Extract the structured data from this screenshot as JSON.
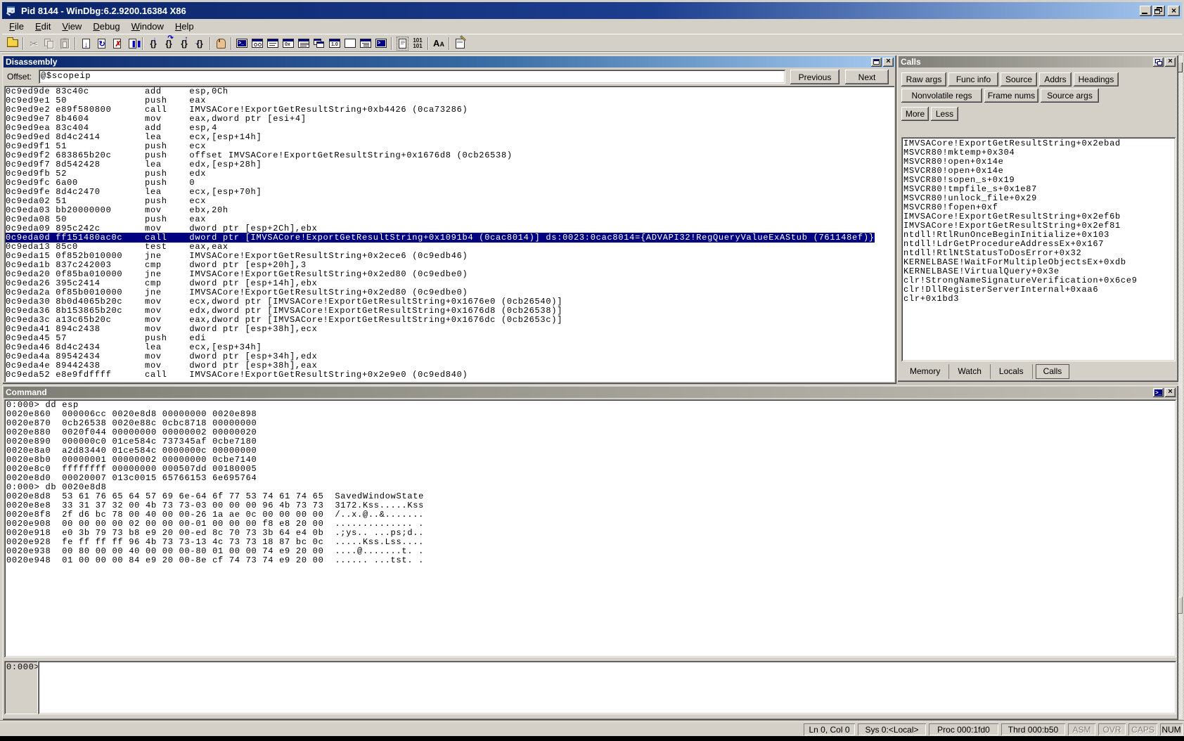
{
  "window": {
    "title": "Pid 8144 - WinDbg:6.2.9200.16384 X86"
  },
  "menu": [
    "File",
    "Edit",
    "View",
    "Debug",
    "Window",
    "Help"
  ],
  "toolbar": {
    "groups": [
      [
        "open-source-file-icon"
      ],
      [
        "cut-icon",
        "copy-icon",
        "paste-icon"
      ],
      [
        "go-icon",
        "restart-icon",
        "stop-debugging-icon",
        "break-icon"
      ],
      [
        "step-into-icon",
        "step-over-icon",
        "step-out-icon",
        "run-to-cursor-icon"
      ],
      [
        "breakpoint-hand-icon"
      ],
      [
        "command-window-icon",
        "watch-window-icon",
        "locals-window-icon",
        "registers-window-icon",
        "memory-window-icon",
        "call-stack-window-icon",
        "disassembly-window-icon",
        "scratch-pad-icon",
        "processes-threads-icon",
        "command-browser-icon"
      ],
      [
        "source-mode-icon",
        "assembly-options-icon"
      ],
      [
        "font-icon"
      ],
      [
        "options-icon"
      ]
    ]
  },
  "disassembly": {
    "title": "Disassembly",
    "offset_label": "Offset:",
    "offset_value": "@$scopeip",
    "previous_label": "Previous",
    "next_label": "Next",
    "highlight_index": 16,
    "lines": [
      "0c9ed9de 83c40c          add     esp,0Ch",
      "0c9ed9e1 50              push    eax",
      "0c9ed9e2 e89f580800      call    IMVSACore!ExportGetResultString+0xb4426 (0ca73286)",
      "0c9ed9e7 8b4604          mov     eax,dword ptr [esi+4]",
      "0c9ed9ea 83c404          add     esp,4",
      "0c9ed9ed 8d4c2414        lea     ecx,[esp+14h]",
      "0c9ed9f1 51              push    ecx",
      "0c9ed9f2 683865b20c      push    offset IMVSACore!ExportGetResultString+0x1676d8 (0cb26538)",
      "0c9ed9f7 8d542428        lea     edx,[esp+28h]",
      "0c9ed9fb 52              push    edx",
      "0c9ed9fc 6a00            push    0",
      "0c9ed9fe 8d4c2470        lea     ecx,[esp+70h]",
      "0c9eda02 51              push    ecx",
      "0c9eda03 bb20000000      mov     ebx,20h",
      "0c9eda08 50              push    eax",
      "0c9eda09 895c242c        mov     dword ptr [esp+2Ch],ebx",
      "0c9eda0d ff151480ac0c    call    dword ptr [IMVSACore!ExportGetResultString+0x1091b4 (0cac8014)] ds:0023:0cac8014={ADVAPI32!RegQueryValueExAStub (761148ef)}",
      "0c9eda13 85c0            test    eax,eax",
      "0c9eda15 0f852b010000    jne     IMVSACore!ExportGetResultString+0x2ece6 (0c9edb46)",
      "0c9eda1b 837c242003      cmp     dword ptr [esp+20h],3",
      "0c9eda20 0f85ba010000    jne     IMVSACore!ExportGetResultString+0x2ed80 (0c9edbe0)",
      "0c9eda26 395c2414        cmp     dword ptr [esp+14h],ebx",
      "0c9eda2a 0f85b0010000    jne     IMVSACore!ExportGetResultString+0x2ed80 (0c9edbe0)",
      "0c9eda30 8b0d4065b20c    mov     ecx,dword ptr [IMVSACore!ExportGetResultString+0x1676e0 (0cb26540)]",
      "0c9eda36 8b153865b20c    mov     edx,dword ptr [IMVSACore!ExportGetResultString+0x1676d8 (0cb26538)]",
      "0c9eda3c a13c65b20c      mov     eax,dword ptr [IMVSACore!ExportGetResultString+0x1676dc (0cb2653c)]",
      "0c9eda41 894c2438        mov     dword ptr [esp+38h],ecx",
      "0c9eda45 57              push    edi",
      "0c9eda46 8d4c2434        lea     ecx,[esp+34h]",
      "0c9eda4a 89542434        mov     dword ptr [esp+34h],edx",
      "0c9eda4e 89442438        mov     dword ptr [esp+38h],eax",
      "0c9eda52 e8e9fdffff      call    IMVSACore!ExportGetResultString+0x2e9e0 (0c9ed840)"
    ]
  },
  "calls": {
    "title": "Calls",
    "buttons_row1": [
      "Raw args",
      "Func info",
      "Source",
      "Addrs",
      "Headings"
    ],
    "buttons_row2": [
      "Nonvolatile regs",
      "Frame nums",
      "Source args"
    ],
    "buttons_row3": [
      "More",
      "Less"
    ],
    "frames": [
      "IMVSACore!ExportGetResultString+0x2ebad",
      "MSVCR80!mktemp+0x304",
      "MSVCR80!open+0x14e",
      "MSVCR80!open+0x14e",
      "MSVCR80!sopen_s+0x19",
      "MSVCR80!tmpfile_s+0x1e87",
      "MSVCR80!unlock_file+0x29",
      "MSVCR80!fopen+0xf",
      "IMVSACore!ExportGetResultString+0x2ef6b",
      "IMVSACore!ExportGetResultString+0x2ef81",
      "ntdll!RtlRunOnceBeginInitialize+0x103",
      "ntdll!LdrGetProcedureAddressEx+0x167",
      "ntdll!RtlNtStatusToDosError+0x32",
      "KERNELBASE!WaitForMultipleObjectsEx+0xdb",
      "KERNELBASE!VirtualQuery+0x3e",
      "clr!StrongNameSignatureVerification+0x6ce9",
      "clr!DllRegisterServerInternal+0xaa6",
      "clr+0x1bd3"
    ],
    "tabs": [
      "Memory",
      "Watch",
      "Locals",
      "Calls"
    ],
    "active_tab": "Calls"
  },
  "command": {
    "title": "Command",
    "prompt": "0:000>",
    "output": [
      "0:000> dd esp",
      "0020e860  000006cc 0020e8d8 00000000 0020e898",
      "0020e870  0cb26538 0020e88c 0cbc8718 00000000",
      "0020e880  0020f044 00000000 00000002 00000020",
      "0020e890  000000c0 01ce584c 737345af 0cbe7180",
      "0020e8a0  a2d83440 01ce584c 0000000c 00000000",
      "0020e8b0  00000001 00000002 00000000 0cbe7140",
      "0020e8c0  ffffffff 00000000 000507dd 00180005",
      "0020e8d0  00020007 013c0015 65766153 6e695764",
      "0:000> db 0020e8d8",
      "0020e8d8  53 61 76 65 64 57 69 6e-64 6f 77 53 74 61 74 65  SavedWindowState",
      "0020e8e8  33 31 37 32 00 4b 73 73-03 00 00 00 96 4b 73 73  3172.Kss.....Kss",
      "0020e8f8  2f d6 bc 78 00 40 00 00-26 1a ae 0c 00 00 00 00  /..x.@..&.......",
      "0020e908  00 00 00 00 02 00 00 00-01 00 00 00 f8 e8 20 00  .............. .",
      "0020e918  e0 3b 79 73 b8 e9 20 00-ed 8c 70 73 3b 64 e4 0b  .;ys.. ...ps;d..",
      "0020e928  fe ff ff ff 96 4b 73 73-13 4c 73 73 18 87 bc 0c  .....Kss.Lss....",
      "0020e938  00 80 00 00 40 00 00 00-80 01 00 00 74 e9 20 00  ....@.......t. .",
      "0020e948  01 00 00 00 84 e9 20 00-8e cf 74 73 74 e9 20 00  ...... ...tst. ."
    ]
  },
  "status_bar": {
    "cells": [
      "Ln 0, Col 0",
      "Sys 0:<Local>",
      "Proc 000:1fd0",
      "Thrd 000:b50"
    ],
    "toggles": [
      {
        "label": "ASM",
        "enabled": false
      },
      {
        "label": "OVR",
        "enabled": false
      },
      {
        "label": "CAPS",
        "enabled": false
      },
      {
        "label": "NUM",
        "enabled": true
      }
    ]
  }
}
